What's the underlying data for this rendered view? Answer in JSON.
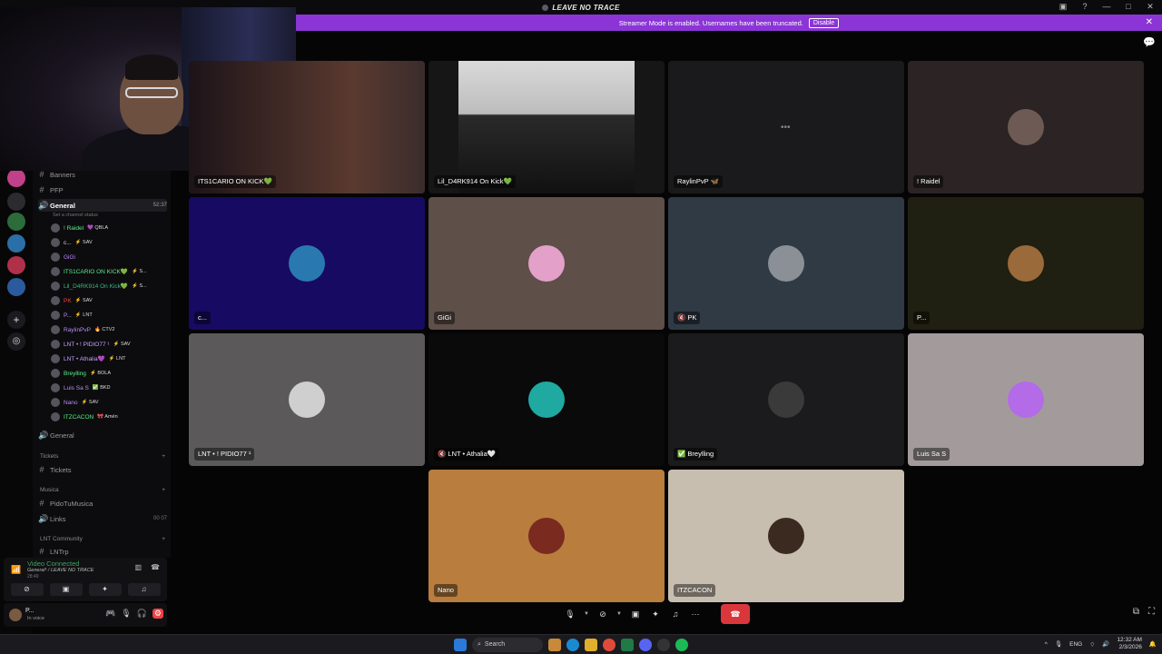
{
  "window": {
    "title": "LEAVE NO TRACE"
  },
  "banner": {
    "text": "Streamer Mode is enabled. Usernames have been truncated.",
    "button": "Disable"
  },
  "channels": {
    "items": [
      {
        "name": "Banners",
        "prefix": "#"
      },
      {
        "name": "PFP",
        "prefix": "#"
      },
      {
        "name": "General",
        "prefix": "🔊",
        "right": "52:37",
        "active": true
      }
    ],
    "status": "Set a channel status",
    "members": [
      {
        "name": "! Raidel",
        "tag": "💜 QBLA",
        "color": "#57f287"
      },
      {
        "name": "c...",
        "tag": "⚡ SAV",
        "color": "#dddddd"
      },
      {
        "name": "GiGi",
        "tag": "",
        "color": "#b98cf5"
      },
      {
        "name": "ITS1CARIO ON KICK💚",
        "tag": "⚡ S...",
        "color": "#57f287"
      },
      {
        "name": "Lil_D4RK914 On Kick💚",
        "tag": "⚡ S...",
        "color": "#43b581"
      },
      {
        "name": "PK",
        "tag": "⚡ SAV",
        "color": "#ed4245"
      },
      {
        "name": "P...",
        "tag": "⚡ LNT",
        "color": "#b98cf5"
      },
      {
        "name": "RaylinPvP",
        "tag": "🔥 CTV2",
        "color": "#b98cf5"
      },
      {
        "name": "LNT • ! PIDIO77 ¹",
        "tag": "⚡ SAV",
        "color": "#c9a0ff"
      },
      {
        "name": "LNT • Athalia💜",
        "tag": "⚡ LNT",
        "color": "#c9a0ff"
      },
      {
        "name": "Breylling",
        "tag": "⚡ BOLA",
        "color": "#57f287"
      },
      {
        "name": "Luis Sa S",
        "tag": "✅ BKD",
        "color": "#b98cf5"
      },
      {
        "name": "Nano",
        "tag": "⚡ SAV",
        "color": "#b98cf5"
      },
      {
        "name": "ITZCACON",
        "tag": "🎀 Amén",
        "color": "#57f287"
      }
    ],
    "after": [
      {
        "name": "General",
        "prefix": "🔊"
      }
    ],
    "cat_tickets": "Tickets",
    "ch_tickets": "Tickets",
    "cat_musica": "Musica",
    "ch_pido": "PidoTuMusica",
    "ch_links": "Links",
    "ch_links_right": "00 07",
    "cat_lnt": "LNT Community",
    "ch_lntrp": "LNTrp"
  },
  "voice": {
    "status": "Video Connected",
    "channel": "General¹ / LEAVE NO TRACE",
    "time": "28:49"
  },
  "user": {
    "name": "P...",
    "status": "In voice"
  },
  "tiles": [
    {
      "label": "ITS1CARIO ON KICK💚",
      "bg": "#3a2a2e",
      "avatar": ""
    },
    {
      "label": "Lil_D4RK914 On Kick💚",
      "bg": "#161616",
      "avatar": ""
    },
    {
      "label": "RaylinPvP 🦋",
      "bg": "#1a1a1c",
      "avatar": ""
    },
    {
      "label": "! Raidel",
      "bg": "#2b2324",
      "avatar": "#6d5a55"
    },
    {
      "label": "c...",
      "bg": "#170a62",
      "avatar": "#2a78b0"
    },
    {
      "label": "GiGi",
      "bg": "#5e4f48",
      "avatar": "#e3a0c8"
    },
    {
      "label": "🔇 PK",
      "bg": "#2f3a44",
      "avatar": "#8a9096"
    },
    {
      "label": "P...",
      "bg": "#1f1f12",
      "avatar": "#9a6a3a"
    },
    {
      "label": "LNT • ! PIDIO77 ¹",
      "bg": "#5b5959",
      "avatar": "#cfcfcf"
    },
    {
      "label": "🔇 LNT • Athalia🤍",
      "bg": "#0a0a0b",
      "avatar": "#1fa9a0"
    },
    {
      "label": "✅ Breylling",
      "bg": "#1b1b1d",
      "avatar": "#3a3a3a"
    },
    {
      "label": "Luis Sa S",
      "bg": "#a39b9b",
      "avatar": "#b36be8"
    },
    {
      "label": "Nano",
      "bg": "#b97d3e",
      "avatar": "#7a2a1e"
    },
    {
      "label": "ITZCACON",
      "bg": "#c8beb0",
      "avatar": "#3a2a20"
    }
  ],
  "taskbar": {
    "search": "Search",
    "lang": "ENG",
    "time": "12:32 AM",
    "date": "2/3/2026"
  },
  "icons": {
    "mic": "🎙",
    "camera": "📷",
    "screen": "🖥",
    "activity": "✦",
    "soundboard": "♫",
    "more": "⋯",
    "hangup": "☎"
  }
}
